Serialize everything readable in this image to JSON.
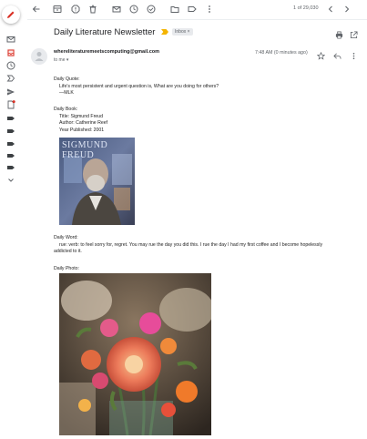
{
  "toolbar": {
    "pager_text": "1 of 29,030"
  },
  "message": {
    "subject": "Daily Literature Newsletter",
    "label_badge": "Inbox ×",
    "sender": "whereliteraturemeetscomputing@gmail.com",
    "to_line": "to me ▾",
    "time": "7:48 AM (0 minutes ago)"
  },
  "body": {
    "quote_heading": "Daily Quote:",
    "quote_text": "Life's most persistent and urgent question is, What are you doing for others?",
    "quote_author": "—MLK",
    "book_heading": "Daily Book:",
    "book_title": "Title: Sigmund Freud",
    "book_author": "Author: Catherine Reef",
    "book_year": "Year Published: 2001",
    "book_cover_text": "SIGMUND FREUD",
    "word_heading": "Daily Word:",
    "word_line1": "rue: verb: to feel sorry for, regret. You may rue the day you did this. I rue the day I had my first coffee and I become hopelessly",
    "word_line2": "addicted to it.",
    "photo_heading": "Daily Photo:"
  },
  "colors": {
    "accent_red": "#d93025",
    "text_gray": "#5f6368",
    "importance_yellow": "#f4b400"
  },
  "icons": {
    "compose": "pencil-icon",
    "back": "arrow-left-icon",
    "archive": "archive-icon",
    "spam": "report-icon",
    "delete": "trash-icon",
    "unread": "envelope-icon",
    "snooze": "clock-icon",
    "task": "add-task-icon",
    "move": "folder-icon",
    "label": "label-icon",
    "more": "more-vert-icon",
    "prev": "chevron-left-icon",
    "next": "chevron-right-icon",
    "print": "print-icon",
    "popout": "open-in-new-icon",
    "star": "star-icon",
    "reply": "reply-icon"
  }
}
